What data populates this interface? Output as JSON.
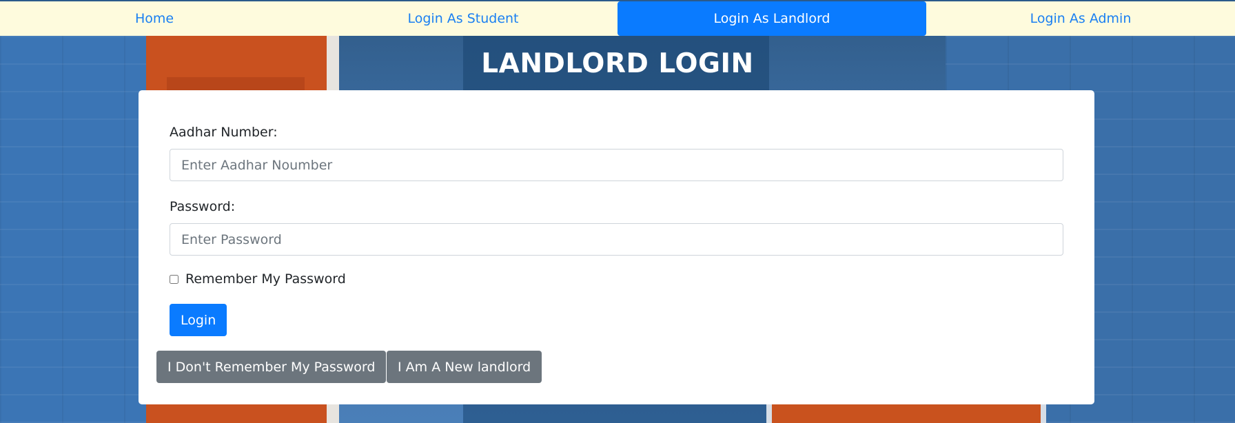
{
  "nav": {
    "items": [
      {
        "label": "Home"
      },
      {
        "label": "Login As Student"
      },
      {
        "label": "Login As Landlord"
      },
      {
        "label": "Login As Admin"
      }
    ],
    "active_index": 2
  },
  "page": {
    "title": "LANDLORD LOGIN"
  },
  "form": {
    "aadhar_label": "Aadhar Number:",
    "aadhar_placeholder": "Enter Aadhar Noumber",
    "aadhar_value": "",
    "password_label": "Password:",
    "password_placeholder": "Enter Password",
    "password_value": "",
    "remember_label": "Remember My Password",
    "remember_checked": false,
    "login_label": "Login",
    "forgot_label": "I Don't Remember My Password",
    "new_landlord_label": "I Am A New landlord"
  },
  "colors": {
    "primary": "#0a7bff",
    "secondary": "#6c757d",
    "nav_background": "#fefbdd",
    "nav_link": "#1a7ff2"
  }
}
